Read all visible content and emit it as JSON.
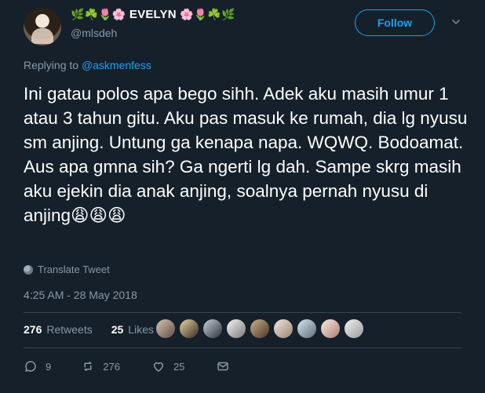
{
  "tweet": {
    "display_name": "EVELYN",
    "name_emojis_left": "🌿☘️🌷🌸",
    "name_emojis_right": "🌸🌷☘️🌿",
    "handle": "@mlsdeh",
    "follow_label": "Follow",
    "replying_prefix": "Replying to ",
    "replying_to": "@askmenfess",
    "text": "Ini gatau polos apa bego sihh. Adek aku masih umur 1 atau 3 tahun gitu. Aku pas masuk ke rumah, dia lg nyusu sm anjing. Untung ga kenapa napa. WQWQ. Bodoamat. Aus apa gmna sih? Ga ngerti lg dah. Sampe skrg masih aku ejekin dia anak anjing, soalnya pernah nyusu di anjing😩😩😩",
    "translate_label": "Translate Tweet",
    "timestamp": "4:25 AM - 28 May 2018",
    "retweets_count": "276",
    "retweets_label": "Retweets",
    "likes_count": "25",
    "likes_label": "Likes",
    "action_counts": {
      "replies": "9",
      "retweets": "276",
      "likes": "25"
    }
  },
  "colors": {
    "background": "#15202b",
    "primary_text": "#ffffff",
    "secondary_text": "#8899a6",
    "accent_blue": "#1da1f2",
    "divider": "#38444d"
  },
  "icons": {
    "more": "chevron-down-icon",
    "translate": "globe-icon",
    "reply": "reply-icon",
    "retweet": "retweet-icon",
    "like": "heart-icon",
    "dm": "envelope-icon"
  }
}
